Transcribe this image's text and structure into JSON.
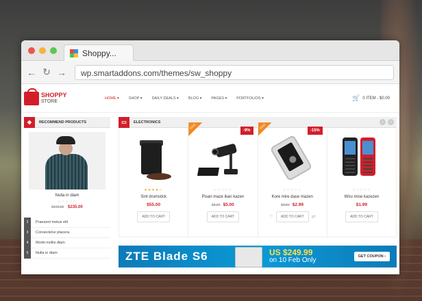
{
  "browser": {
    "tab_title": "Shoppy...",
    "url": "wp.smartaddons.com/themes/sw_shoppy"
  },
  "site": {
    "logo": {
      "line1": "SHOPPY",
      "line2": "STORE"
    },
    "menu": [
      {
        "label": "HOME ▾",
        "active": true
      },
      {
        "label": "SHOP ▾",
        "active": false
      },
      {
        "label": "DAILY DEALS ▾",
        "active": false
      },
      {
        "label": "BLOG ▾",
        "active": false
      },
      {
        "label": "PAGES ▾",
        "active": false
      },
      {
        "label": "PORTFOLIOS ▾",
        "active": false
      }
    ],
    "cart": "0 ITEM - $0.00"
  },
  "recommend": {
    "heading": "RECOMMEND PRODUCTS",
    "product": {
      "name": "Nulla in diam",
      "stars": "☆☆☆☆☆",
      "old_price": "$340.00",
      "price": "$235.00"
    },
    "ranked": [
      {
        "num": "2",
        "label": "Praesent metus elit"
      },
      {
        "num": "3",
        "label": "Consectetur placera"
      },
      {
        "num": "4",
        "label": "Morbi mollis diam"
      },
      {
        "num": "5",
        "label": "Nulla in diam"
      }
    ]
  },
  "electronics": {
    "heading": "ELECTRONICS",
    "products": [
      {
        "name": "Sint drumstick",
        "stars": "★★★★☆",
        "price": "$55.00",
        "old_price": "",
        "sale": "",
        "discount": "",
        "add": "ADD TO CART"
      },
      {
        "name": "Pisan maze ikan kazen",
        "stars": "☆☆☆☆☆",
        "price": "$5.00",
        "old_price": "$9.00",
        "sale": "SALE",
        "discount": "-9%",
        "add": "ADD TO CART"
      },
      {
        "name": "Kore mire dase mazen",
        "stars": "☆☆☆☆☆",
        "price": "$2.99",
        "old_price": "$3.50",
        "sale": "SALE",
        "discount": "-15%",
        "add": "ADD TO CART"
      },
      {
        "name": "Wiru mise kazezen",
        "stars": "☆☆☆☆☆",
        "price": "$1.99",
        "old_price": "",
        "sale": "",
        "discount": "",
        "add": "ADD TO CART"
      }
    ]
  },
  "banner": {
    "title": "ZTE Blade S6",
    "price": "US $249.99",
    "date": "on 10 Feb Only",
    "coupon": "GET COUPON ›"
  }
}
